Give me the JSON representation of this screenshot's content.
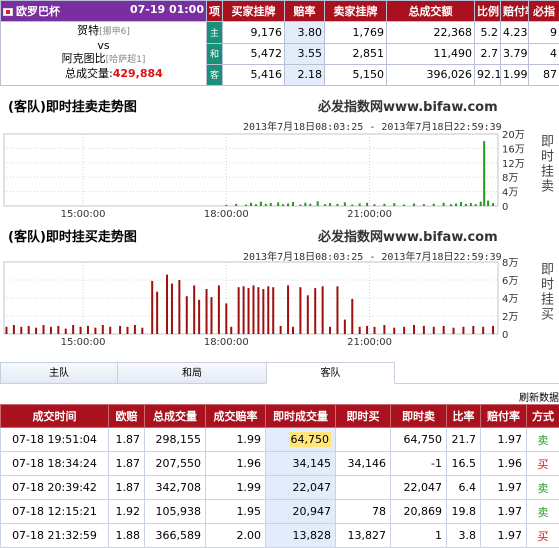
{
  "match": {
    "league": "欧罗巴杯",
    "time": "07-19 01:00",
    "home": "贺特",
    "home_tag": "[挪甲6]",
    "vs": "vs",
    "away": "阿克图比",
    "away_tag": "[哈萨超1]",
    "volume_label": "总成交量:",
    "volume": "429,884"
  },
  "top_headers": [
    "项",
    "买家挂牌",
    "赔率",
    "卖家挂牌",
    "总成交额",
    "比例",
    "赔付率",
    "必指"
  ],
  "top_rows": [
    {
      "label": "主",
      "buy": "9,176",
      "odds": "3.80",
      "sell": "1,769",
      "total": "22,368",
      "ratio": "5.2",
      "pay": "4.23",
      "idx": "9"
    },
    {
      "label": "和",
      "buy": "5,472",
      "odds": "3.55",
      "sell": "2,851",
      "total": "11,490",
      "ratio": "2.7",
      "pay": "3.79",
      "idx": "4"
    },
    {
      "label": "客",
      "buy": "5,416",
      "odds": "2.18",
      "sell": "5,150",
      "total": "396,026",
      "ratio": "92.1",
      "pay": "1.99",
      "idx": "87"
    }
  ],
  "chart1": {
    "title": "(客队)即时挂卖走势图",
    "site": "必发指数网www.bifaw.com",
    "range": "2013年7月18日08:03:25 - 2013年7月18日22:59:39",
    "side_label": "即时挂卖"
  },
  "chart2": {
    "title": "(客队)即时挂买走势图",
    "site": "必发指数网www.bifaw.com",
    "range": "2013年7月18日08:03:25 - 2013年7月18日22:59:39",
    "side_label": "即时挂买"
  },
  "chart_data": [
    {
      "type": "bar",
      "title": "(客队)即时挂卖走势图",
      "x_ticks": [
        "15:00:00",
        "18:00:00",
        "21:00:00"
      ],
      "y_ticks": [
        "20万",
        "16万",
        "12万",
        "8万",
        "4万",
        "0"
      ],
      "ylim": [
        0,
        20
      ],
      "y_unit": "万",
      "color": "#1e9a1e",
      "bars": [
        {
          "t": 0.45,
          "v": 0.3
        },
        {
          "t": 0.47,
          "v": 0.6
        },
        {
          "t": 0.49,
          "v": 0.4
        },
        {
          "t": 0.5,
          "v": 0.9
        },
        {
          "t": 0.51,
          "v": 0.5
        },
        {
          "t": 0.52,
          "v": 1.2
        },
        {
          "t": 0.53,
          "v": 0.6
        },
        {
          "t": 0.54,
          "v": 0.8
        },
        {
          "t": 0.555,
          "v": 1.0
        },
        {
          "t": 0.565,
          "v": 0.5
        },
        {
          "t": 0.575,
          "v": 0.7
        },
        {
          "t": 0.585,
          "v": 1.1
        },
        {
          "t": 0.6,
          "v": 0.4
        },
        {
          "t": 0.61,
          "v": 0.9
        },
        {
          "t": 0.62,
          "v": 0.6
        },
        {
          "t": 0.635,
          "v": 1.3
        },
        {
          "t": 0.65,
          "v": 0.5
        },
        {
          "t": 0.66,
          "v": 0.8
        },
        {
          "t": 0.675,
          "v": 0.6
        },
        {
          "t": 0.69,
          "v": 1.0
        },
        {
          "t": 0.705,
          "v": 0.4
        },
        {
          "t": 0.72,
          "v": 0.7
        },
        {
          "t": 0.735,
          "v": 0.9
        },
        {
          "t": 0.75,
          "v": 0.5
        },
        {
          "t": 0.77,
          "v": 0.6
        },
        {
          "t": 0.79,
          "v": 0.8
        },
        {
          "t": 0.81,
          "v": 0.4
        },
        {
          "t": 0.83,
          "v": 0.7
        },
        {
          "t": 0.85,
          "v": 0.5
        },
        {
          "t": 0.87,
          "v": 0.6
        },
        {
          "t": 0.89,
          "v": 0.9
        },
        {
          "t": 0.905,
          "v": 0.5
        },
        {
          "t": 0.915,
          "v": 0.7
        },
        {
          "t": 0.925,
          "v": 1.1
        },
        {
          "t": 0.935,
          "v": 0.6
        },
        {
          "t": 0.945,
          "v": 0.8
        },
        {
          "t": 0.955,
          "v": 0.5
        },
        {
          "t": 0.965,
          "v": 1.2
        },
        {
          "t": 0.972,
          "v": 18.0
        },
        {
          "t": 0.98,
          "v": 1.5
        },
        {
          "t": 0.99,
          "v": 0.8
        }
      ]
    },
    {
      "type": "bar",
      "title": "(客队)即时挂买走势图",
      "x_ticks": [
        "15:00:00",
        "18:00:00",
        "21:00:00"
      ],
      "y_ticks": [
        "8万",
        "6万",
        "4万",
        "2万",
        "0"
      ],
      "ylim": [
        0,
        8
      ],
      "y_unit": "万",
      "color": "#9e1010",
      "bars": [
        {
          "t": 0.005,
          "v": 0.8
        },
        {
          "t": 0.02,
          "v": 1.0
        },
        {
          "t": 0.035,
          "v": 0.8
        },
        {
          "t": 0.05,
          "v": 0.9
        },
        {
          "t": 0.065,
          "v": 0.7
        },
        {
          "t": 0.08,
          "v": 1.0
        },
        {
          "t": 0.095,
          "v": 0.8
        },
        {
          "t": 0.11,
          "v": 0.9
        },
        {
          "t": 0.125,
          "v": 0.6
        },
        {
          "t": 0.14,
          "v": 1.0
        },
        {
          "t": 0.155,
          "v": 0.8
        },
        {
          "t": 0.17,
          "v": 0.9
        },
        {
          "t": 0.185,
          "v": 0.7
        },
        {
          "t": 0.2,
          "v": 1.0
        },
        {
          "t": 0.215,
          "v": 0.8
        },
        {
          "t": 0.235,
          "v": 0.9
        },
        {
          "t": 0.25,
          "v": 0.8
        },
        {
          "t": 0.265,
          "v": 1.0
        },
        {
          "t": 0.28,
          "v": 0.7
        },
        {
          "t": 0.3,
          "v": 5.9
        },
        {
          "t": 0.31,
          "v": 4.7
        },
        {
          "t": 0.33,
          "v": 6.6
        },
        {
          "t": 0.34,
          "v": 5.6
        },
        {
          "t": 0.355,
          "v": 6.0
        },
        {
          "t": 0.37,
          "v": 4.2
        },
        {
          "t": 0.385,
          "v": 5.4
        },
        {
          "t": 0.395,
          "v": 3.8
        },
        {
          "t": 0.41,
          "v": 5.0
        },
        {
          "t": 0.42,
          "v": 4.1
        },
        {
          "t": 0.435,
          "v": 5.4
        },
        {
          "t": 0.45,
          "v": 3.4
        },
        {
          "t": 0.46,
          "v": 0.8
        },
        {
          "t": 0.475,
          "v": 5.2
        },
        {
          "t": 0.485,
          "v": 5.3
        },
        {
          "t": 0.495,
          "v": 5.1
        },
        {
          "t": 0.505,
          "v": 5.4
        },
        {
          "t": 0.515,
          "v": 5.2
        },
        {
          "t": 0.525,
          "v": 5.0
        },
        {
          "t": 0.535,
          "v": 5.3
        },
        {
          "t": 0.545,
          "v": 5.2
        },
        {
          "t": 0.56,
          "v": 0.9
        },
        {
          "t": 0.575,
          "v": 5.4
        },
        {
          "t": 0.585,
          "v": 0.8
        },
        {
          "t": 0.6,
          "v": 5.2
        },
        {
          "t": 0.615,
          "v": 4.3
        },
        {
          "t": 0.63,
          "v": 5.1
        },
        {
          "t": 0.645,
          "v": 5.3
        },
        {
          "t": 0.66,
          "v": 0.8
        },
        {
          "t": 0.675,
          "v": 5.3
        },
        {
          "t": 0.69,
          "v": 1.6
        },
        {
          "t": 0.705,
          "v": 3.9
        },
        {
          "t": 0.72,
          "v": 0.8
        },
        {
          "t": 0.735,
          "v": 0.9
        },
        {
          "t": 0.75,
          "v": 0.8
        },
        {
          "t": 0.77,
          "v": 1.0
        },
        {
          "t": 0.79,
          "v": 0.7
        },
        {
          "t": 0.81,
          "v": 0.8
        },
        {
          "t": 0.83,
          "v": 1.0
        },
        {
          "t": 0.85,
          "v": 0.9
        },
        {
          "t": 0.87,
          "v": 0.8
        },
        {
          "t": 0.89,
          "v": 0.9
        },
        {
          "t": 0.91,
          "v": 0.7
        },
        {
          "t": 0.93,
          "v": 0.8
        },
        {
          "t": 0.95,
          "v": 0.9
        },
        {
          "t": 0.97,
          "v": 0.8
        },
        {
          "t": 0.99,
          "v": 0.9
        }
      ]
    }
  ],
  "tabs": [
    "主队",
    "和局",
    "客队"
  ],
  "refresh_label": "刷新数据",
  "bottom_headers": [
    "成交时间",
    "欧赔",
    "总成交量",
    "成交赔率",
    "即时成交量",
    "即时买",
    "即时卖",
    "比率",
    "赔付率",
    "方式"
  ],
  "bottom_rows": [
    {
      "time": "07-18 19:51:04",
      "eu": "1.87",
      "vol": "298,155",
      "odds": "1.99",
      "inst": "64,750",
      "buy": "",
      "sell": "64,750",
      "ratio": "21.7",
      "pay": "1.97",
      "way": "卖",
      "wc": "g",
      "hl": true
    },
    {
      "time": "07-18 18:34:24",
      "eu": "1.87",
      "vol": "207,550",
      "odds": "1.96",
      "inst": "34,145",
      "buy": "34,146",
      "sell": "-1",
      "ratio": "16.5",
      "pay": "1.96",
      "way": "买",
      "wc": "r",
      "hl": false
    },
    {
      "time": "07-18 20:39:42",
      "eu": "1.87",
      "vol": "342,708",
      "odds": "1.99",
      "inst": "22,047",
      "buy": "",
      "sell": "22,047",
      "ratio": "6.4",
      "pay": "1.97",
      "way": "卖",
      "wc": "g",
      "hl": false
    },
    {
      "time": "07-18 12:15:21",
      "eu": "1.92",
      "vol": "105,938",
      "odds": "1.95",
      "inst": "20,947",
      "buy": "78",
      "sell": "20,869",
      "ratio": "19.8",
      "pay": "1.97",
      "way": "卖",
      "wc": "g",
      "hl": false
    },
    {
      "time": "07-18 21:32:59",
      "eu": "1.88",
      "vol": "366,589",
      "odds": "2.00",
      "inst": "13,828",
      "buy": "13,827",
      "sell": "1",
      "ratio": "3.8",
      "pay": "1.97",
      "way": "买",
      "wc": "r",
      "hl": false
    }
  ]
}
